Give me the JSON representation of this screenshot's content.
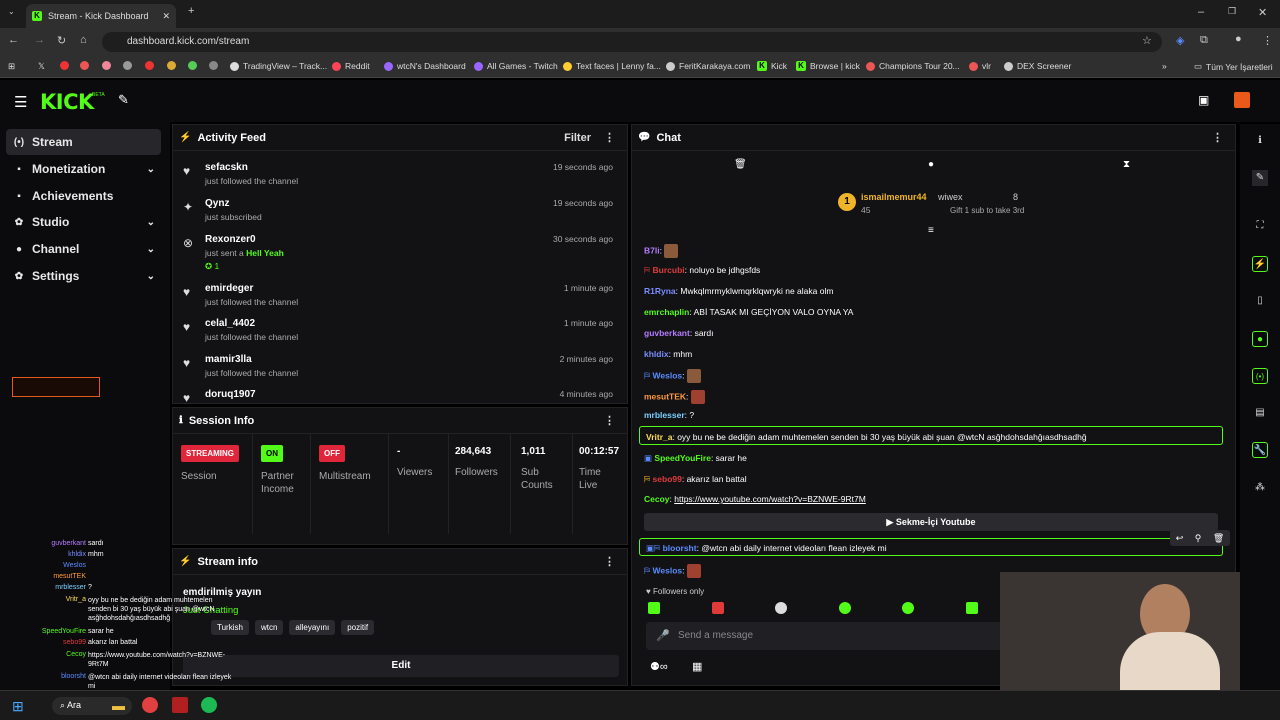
{
  "browser": {
    "tab_title": "Stream - Kick Dashboard",
    "url": "dashboard.kick.com/stream",
    "bookmarks": [
      "TradingView – Track...",
      "Reddit",
      "wtcN's Dashboard",
      "All Games - Twitch",
      "Text faces | Lenny fa...",
      "FeritKarakaya.com",
      "Kick",
      "Browse | kick",
      "Champions Tour 20...",
      "vlr",
      "DEX Screener"
    ],
    "all_bookmarks": "Tüm Yer İşaretleri"
  },
  "app": {
    "logo": "KICK",
    "beta": "BETA"
  },
  "sidebar": {
    "items": [
      {
        "label": "Stream",
        "icon": "radio-icon"
      },
      {
        "label": "Monetization",
        "icon": "wallet-icon"
      },
      {
        "label": "Achievements",
        "icon": "trophy-icon"
      },
      {
        "label": "Studio",
        "icon": "gear-icon"
      },
      {
        "label": "Channel",
        "icon": "user-icon"
      },
      {
        "label": "Settings",
        "icon": "settings-icon"
      }
    ]
  },
  "activity": {
    "title": "Activity Feed",
    "filter": "Filter",
    "items": [
      {
        "name": "sefacskn",
        "desc": "just followed the channel",
        "time": "19 seconds ago",
        "icon": "heart-icon"
      },
      {
        "name": "Qynz",
        "desc": "just subscribed",
        "time": "19 seconds ago",
        "icon": "sparkle-icon"
      },
      {
        "name": "Rexonzer0",
        "desc": "just sent a",
        "extra": "Hell Yeah",
        "count": "1",
        "time": "30 seconds ago",
        "icon": "circle-x-icon"
      },
      {
        "name": "emirdeger",
        "desc": "just followed the channel",
        "time": "1 minute ago",
        "icon": "heart-icon"
      },
      {
        "name": "celal_4402",
        "desc": "just followed the channel",
        "time": "1 minute ago",
        "icon": "heart-icon"
      },
      {
        "name": "mamir3lla",
        "desc": "just followed the channel",
        "time": "2 minutes ago",
        "icon": "heart-icon"
      },
      {
        "name": "doruq1907",
        "desc": "",
        "time": "4 minutes ago",
        "icon": "heart-icon"
      }
    ]
  },
  "session": {
    "title": "Session Info",
    "streaming": "STREAMING",
    "session_label": "Session",
    "on": "ON",
    "partner": "Partner Income",
    "off": "OFF",
    "multistream": "Multistream",
    "viewers_val": "-",
    "viewers": "Viewers",
    "followers_val": "284,643",
    "followers": "Followers",
    "subs_val": "1,011",
    "subs": "Sub Counts",
    "time_val": "00:12:57",
    "time": "Time Live"
  },
  "streaminfo": {
    "title": "Stream info",
    "stream_title": "emdirilmiş yayın",
    "category": "Just Chatting",
    "tags": [
      "Turkish",
      "wtcn",
      "alleyayını",
      "pozitif"
    ],
    "edit": "Edit"
  },
  "chat": {
    "title": "Chat",
    "top_name": "ismailmemur44",
    "top_count": "45",
    "second_name": "wiwex",
    "second_count": "8",
    "gift_text": "Gift 1 sub to take 3rd",
    "rank": "1",
    "messages": [
      {
        "user": "B7li",
        "color": "#b57bff",
        "text": ""
      },
      {
        "user": "Burcubi",
        "color": "#e03a3a",
        "text": "noluyo be jdhgsfds"
      },
      {
        "user": "R1Ryna",
        "color": "#7b8dff",
        "text": "Mwkqlmrmyklwmqrklqwryki ne alaka olm"
      },
      {
        "user": "emrchaplin",
        "color": "#53fc18",
        "text": "ABİ TASAK MI GEÇİYON VALO OYNA YA"
      },
      {
        "user": "guvberkant",
        "color": "#b57bff",
        "text": "sardı"
      },
      {
        "user": "khldix",
        "color": "#7b8dff",
        "text": "mhm"
      },
      {
        "user": "Weslos",
        "color": "#5b8cff",
        "text": ""
      },
      {
        "user": "mesutTEK",
        "color": "#ff9b3a",
        "text": ""
      },
      {
        "user": "mrblesser",
        "color": "#7bd0ff",
        "text": "?"
      },
      {
        "user": "Vritr_a",
        "color": "#ffdc5a",
        "text": "oyy bu ne be dediğin adam muhtemelen senden bi 30 yaş büyük abi şuan @wtcN asğhdohsdahğıasdhsadhğ"
      },
      {
        "user": "SpeedYouFire",
        "color": "#53fc18",
        "text": "sarar he"
      },
      {
        "user": "sebo99",
        "color": "#e03a3a",
        "text": "akarız lan battal"
      },
      {
        "user": "Cecoy",
        "color": "#53fc18",
        "text": "https://www.youtube.com/watch?v=BZNWE-9Rt7M"
      },
      {
        "user": "bloorsht",
        "color": "#5b8cff",
        "text": "@wtcn abi daily internet videoları flean izleyek mi"
      },
      {
        "user": "Weslos",
        "color": "#5b8cff",
        "text": ""
      }
    ],
    "embed": "Sekme-İçi Youtube",
    "followers_only": "Followers only",
    "placeholder": "Send a message"
  },
  "overlay": {
    "lines": [
      [
        "guvberkant",
        "sardı"
      ],
      [
        "khldix",
        "mhm"
      ],
      [
        "Weslos",
        ""
      ],
      [
        "mesutTEK",
        ""
      ],
      [
        "mrblesser",
        "?"
      ],
      [
        "Vritr_a",
        "oyy bu ne be dediğin adam muhtemelen senden bi 30 yaş büyük abi şuan @wtcN asğhdohsdahğıasdhsadhğ"
      ],
      [
        "SpeedYouFire",
        "sarar he"
      ],
      [
        "sebo99",
        "akarız lan battal"
      ],
      [
        "Cecoy",
        "https://www.youtube.com/watch?v=BZNWE-9Rt7M"
      ],
      [
        "bloorsht",
        "@wtcn abi daily internet videoları flean izleyek mi"
      ]
    ]
  },
  "taskbar": {
    "search": "Ara"
  },
  "colors": {
    "accent": "#53fc18",
    "bg": "#0b0b0d",
    "panel": "#121215",
    "live": "#e0263a"
  }
}
